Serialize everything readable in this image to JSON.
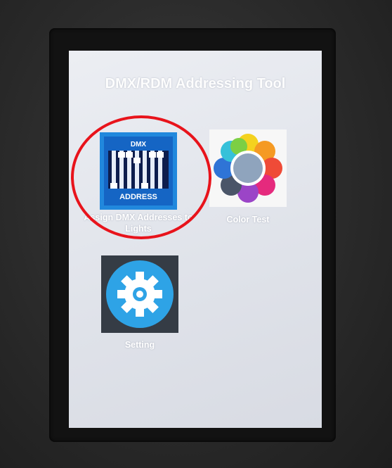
{
  "screen": {
    "title": "DMX/RDM Addressing Tool"
  },
  "apps": [
    {
      "label": "Assign DMX Addresses to Lights",
      "icon": "dmx-address-sliders-icon",
      "icon_text_top": "DMX",
      "icon_text_bottom": "ADDRESS",
      "highlighted": true
    },
    {
      "label": "Color Test",
      "icon": "color-petals-icon"
    },
    {
      "label": "Setting",
      "icon": "gear-icon"
    }
  ],
  "colors": {
    "highlight_ring": "#e8131b",
    "dmx_tile": "#1f7fd6",
    "settings_tile": "#323a44",
    "settings_circle": "#2ea3e6",
    "screen_background": "#e4e7ee"
  }
}
